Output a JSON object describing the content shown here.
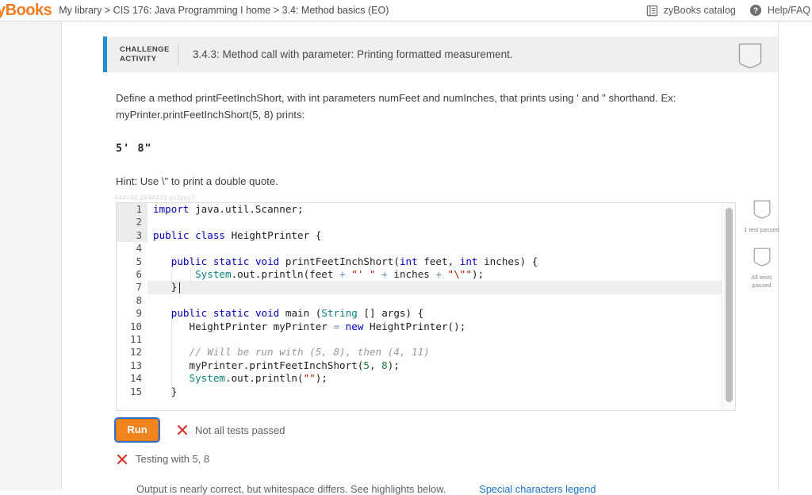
{
  "topbar": {
    "logo": "yBooks",
    "breadcrumb": "My library > CIS 176: Java Programming I home > 3.4: Method basics (EO)",
    "catalog_label": "zyBooks catalog",
    "help_label": "Help/FAQ",
    "catalog_icon": "book-icon",
    "help_icon": "question-circle-icon"
  },
  "activity": {
    "tag_line1": "CHALLENGE",
    "tag_line2": "ACTIVITY",
    "title": "3.4.3: Method call with parameter: Printing formatted measurement.",
    "badge_icon": "shield-badge-icon",
    "accent_color": "#1f8ecd"
  },
  "prompt": {
    "paragraph": "Define a method printFeetInchShort, with int parameters numFeet and numInches, that prints using ' and \" shorthand. Ex: myPrinter.printFeetInchShort(5, 8) prints:",
    "sample_output": "5'  8\"",
    "hint": "Hint: Use \\\" to print a double quote."
  },
  "editor": {
    "watermark": "444740.2644432.qx3zqy7",
    "line_numbers": [
      "1",
      "2",
      "3",
      "4",
      "5",
      "6",
      "7",
      "8",
      "9",
      "10",
      "11",
      "12",
      "13",
      "14",
      "15"
    ],
    "active_line": 7,
    "lines": [
      "import java.util.Scanner;",
      "",
      "public class HeightPrinter {",
      "",
      "   public static void printFeetInchShort(int feet, int inches) {",
      "       System.out.println(feet + \"' \" + inches + \"\\\"\");",
      "   }",
      "",
      "   public static void main (String [] args) {",
      "      HeightPrinter myPrinter = new HeightPrinter();",
      "",
      "      // Will be run with (5, 8), then (4, 11)",
      "      myPrinter.printFeetInchShort(5, 8);",
      "      System.out.println(\"\");",
      "   }"
    ],
    "scrollbar": "vertical-scrollbar"
  },
  "side_tests": [
    {
      "icon": "shield-badge-icon",
      "label": "1 test passed"
    },
    {
      "icon": "shield-badge-icon",
      "label": "All tests passed"
    }
  ],
  "results": {
    "run_label": "Run",
    "status": "Not all tests passed",
    "status_icon": "x-mark-icon",
    "test_case": "Testing with 5, 8",
    "test_case_icon": "x-mark-icon",
    "detail": "Output is nearly correct, but whitespace differs. See highlights below.",
    "detail_link": "Special characters legend",
    "error_color": "#d93025",
    "link_color": "#1a73c8"
  }
}
